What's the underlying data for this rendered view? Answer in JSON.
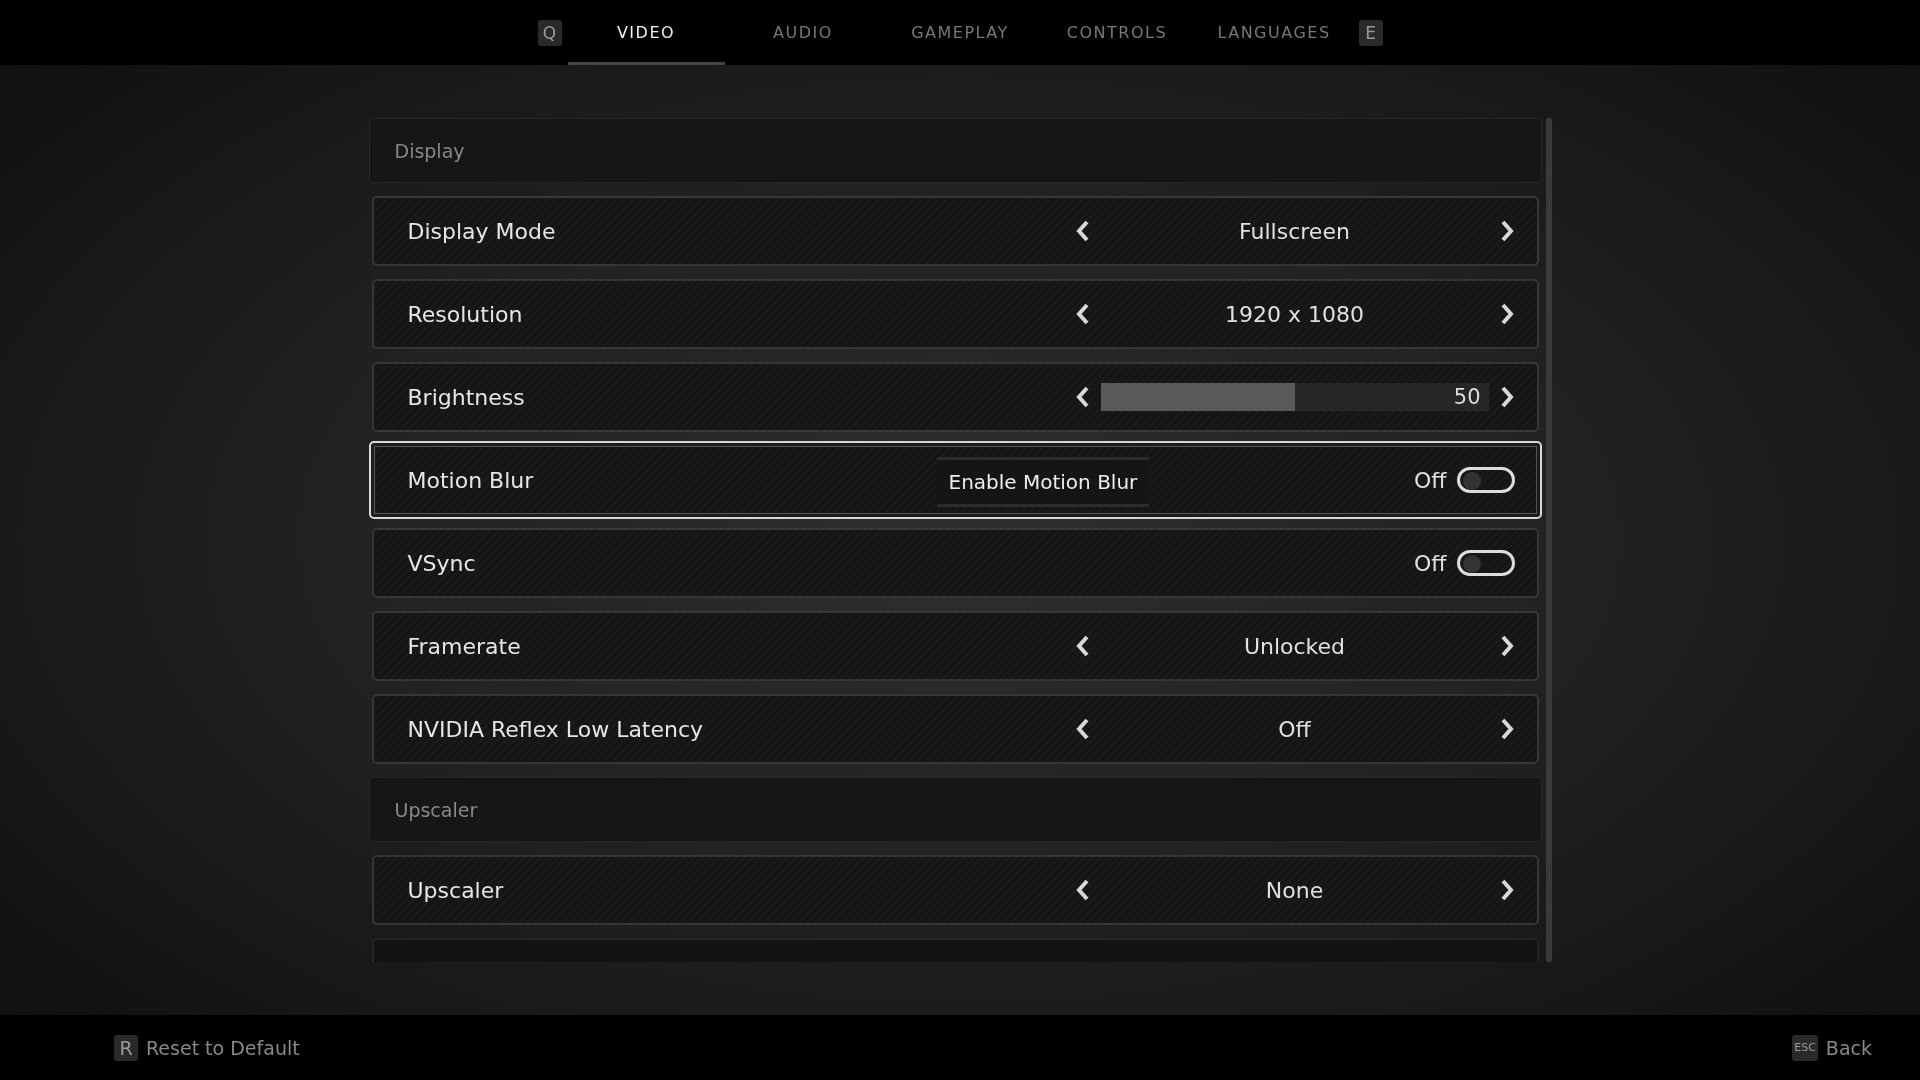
{
  "top_bar": {
    "prev_key": "Q",
    "next_key": "E",
    "tabs": [
      {
        "label": "VIDEO",
        "selected": true
      },
      {
        "label": "AUDIO",
        "selected": false
      },
      {
        "label": "GAMEPLAY",
        "selected": false
      },
      {
        "label": "CONTROLS",
        "selected": false
      },
      {
        "label": "LANGUAGES",
        "selected": false
      }
    ]
  },
  "settings": [
    {
      "kind": "section",
      "label": "Display"
    },
    {
      "kind": "selector",
      "label": "Display Mode",
      "value": "Fullscreen",
      "selected": false
    },
    {
      "kind": "selector",
      "label": "Resolution",
      "value": "1920 x 1080",
      "selected": false
    },
    {
      "kind": "slider",
      "label": "Brightness",
      "level": 0.5,
      "reading": "50",
      "selected": false
    },
    {
      "kind": "toggle",
      "label": "Motion Blur",
      "value": "Off",
      "on": false,
      "selected": true,
      "tooltip": "Enable Motion Blur"
    },
    {
      "kind": "toggle",
      "label": "VSync",
      "value": "Off",
      "on": false,
      "selected": false
    },
    {
      "kind": "selector",
      "label": "Framerate",
      "value": "Unlocked",
      "selected": false
    },
    {
      "kind": "selector",
      "label": "NVIDIA Reflex Low Latency",
      "value": "Off",
      "selected": false
    },
    {
      "kind": "section",
      "label": "Upscaler"
    },
    {
      "kind": "selector",
      "label": "Upscaler",
      "value": "None",
      "selected": false
    }
  ],
  "bottom_bar": {
    "reset": {
      "key": "R",
      "label": "Reset to Default"
    },
    "back": {
      "key": "ESC",
      "label": "Back"
    }
  }
}
